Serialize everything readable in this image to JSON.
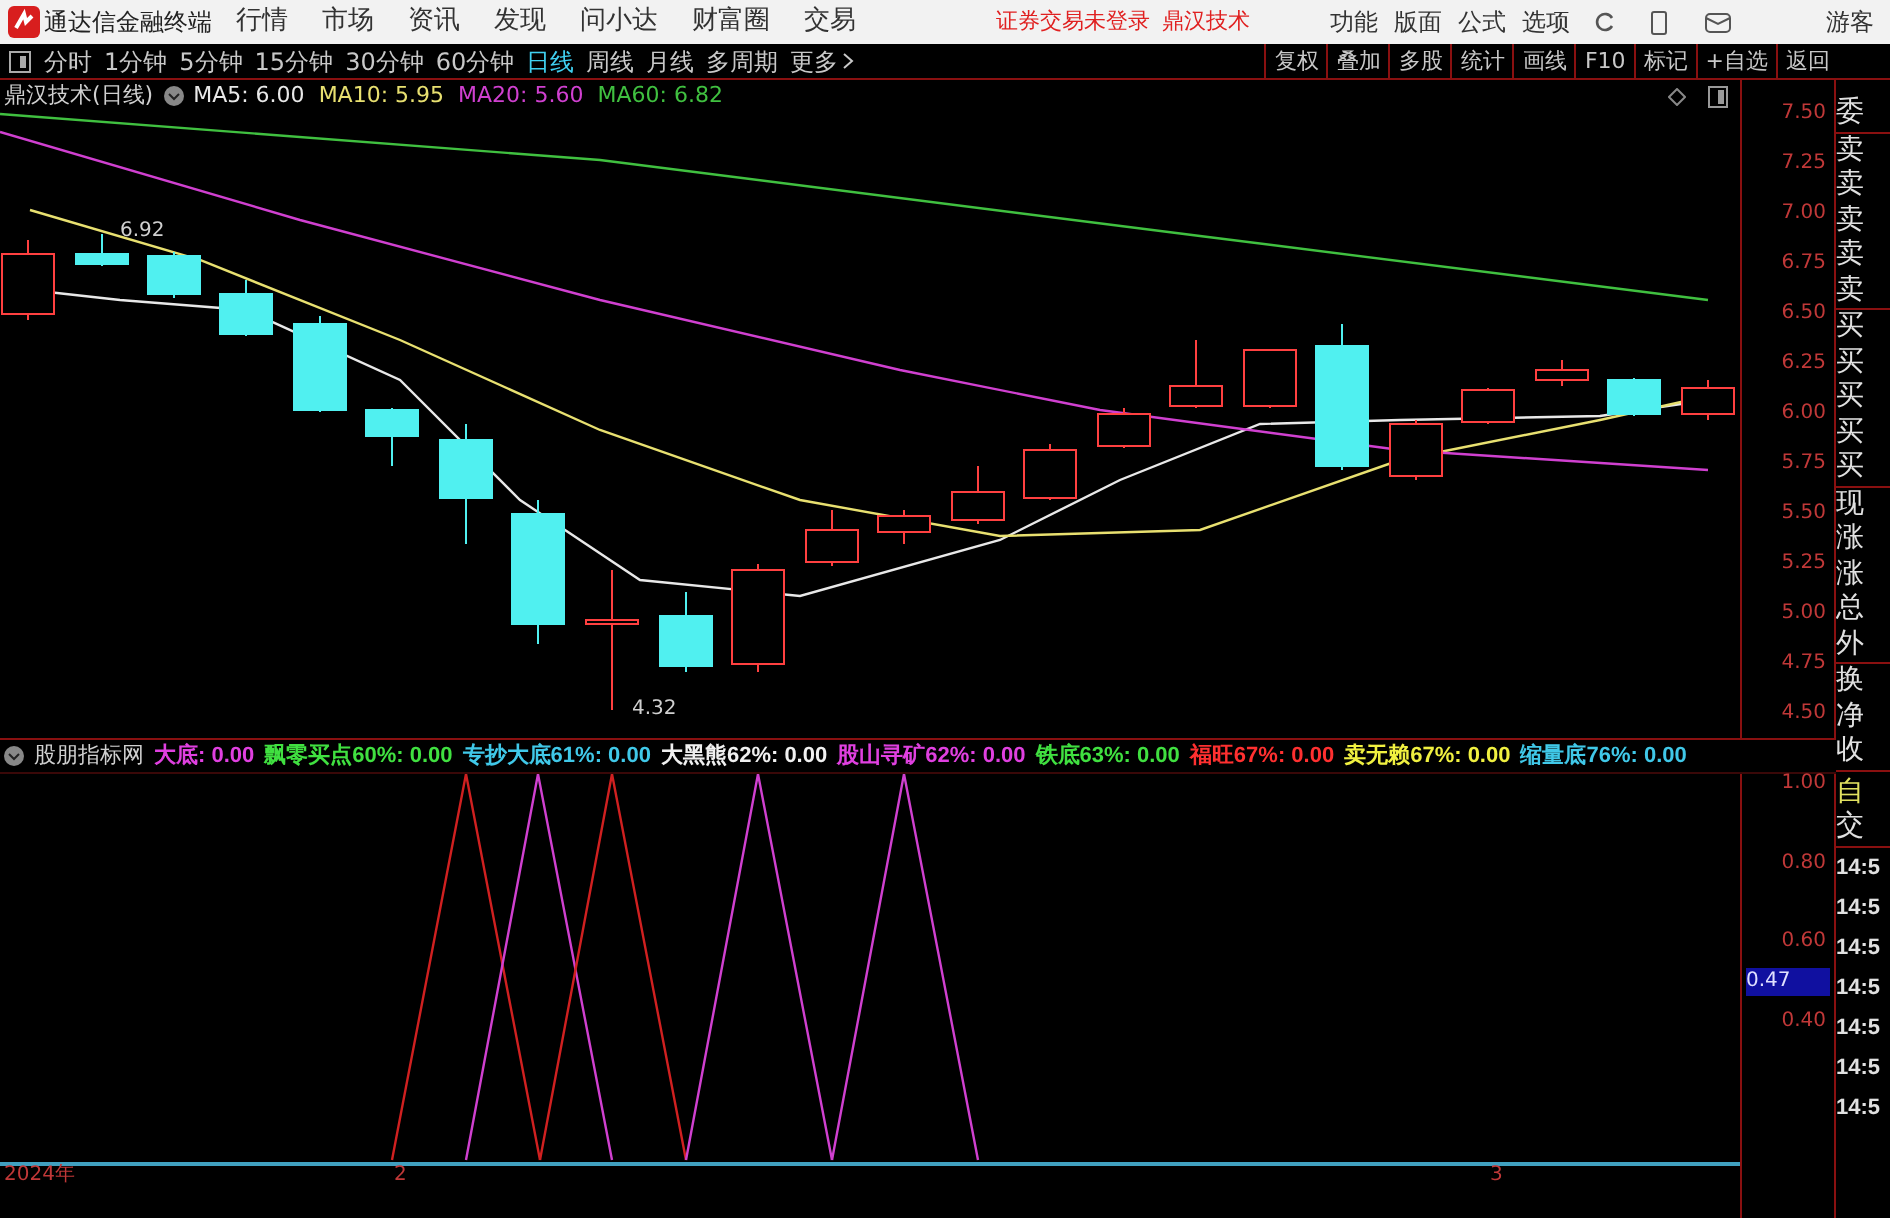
{
  "app_bar": {
    "title": "通达信金融终端",
    "menu": [
      "行情",
      "市场",
      "资讯",
      "发现",
      "问小达",
      "财富圈",
      "交易"
    ],
    "notices": [
      "证券交易未登录",
      "鼎汉技术"
    ],
    "right_menu": [
      "功能",
      "版面",
      "公式",
      "选项"
    ],
    "user": "游客"
  },
  "period_tabs": [
    {
      "label": "分时",
      "selected": false
    },
    {
      "label": "1分钟",
      "selected": false
    },
    {
      "label": "5分钟",
      "selected": false
    },
    {
      "label": "15分钟",
      "selected": false
    },
    {
      "label": "30分钟",
      "selected": false
    },
    {
      "label": "60分钟",
      "selected": false
    },
    {
      "label": "日线",
      "selected": true
    },
    {
      "label": "周线",
      "selected": false
    },
    {
      "label": "月线",
      "selected": false
    },
    {
      "label": "多周期",
      "selected": false
    },
    {
      "label": "更多",
      "selected": false
    }
  ],
  "tool_buttons": [
    "复权",
    "叠加",
    "多股",
    "统计",
    "画线",
    "F10",
    "标记",
    "+自选",
    "返回"
  ],
  "main_chart": {
    "title": "鼎汉技术(日线)",
    "ma": [
      {
        "label": "MA5: 6.00",
        "color": "#e8e8e8"
      },
      {
        "label": "MA10: 5.95",
        "color": "#e8e070"
      },
      {
        "label": "MA20: 5.60",
        "color": "#d040d0"
      },
      {
        "label": "MA60: 6.82",
        "color": "#40c040"
      }
    ],
    "price_ticks": [
      "7.50",
      "7.25",
      "7.00",
      "6.75",
      "6.50",
      "6.25",
      "6.00",
      "5.75",
      "5.50",
      "5.25",
      "5.00",
      "4.75",
      "4.50"
    ],
    "high_label": "6.92",
    "low_label": "4.32"
  },
  "indicator": {
    "title": "股朋指标网",
    "readouts": [
      {
        "label": "大底: 0.00",
        "color": "#e040e0"
      },
      {
        "label": "飘零买点60%: 0.00",
        "color": "#40e040"
      },
      {
        "label": "专抄大底61%: 0.00",
        "color": "#40c8e8"
      },
      {
        "label": "大黑熊62%: 0.00",
        "color": "#f0f0f0"
      },
      {
        "label": "股山寻矿62%: 0.00",
        "color": "#e040e0"
      },
      {
        "label": "铁底63%: 0.00",
        "color": "#40e040"
      },
      {
        "label": "福旺67%: 0.00",
        "color": "#ff3030"
      },
      {
        "label": "卖无赖67%: 0.00",
        "color": "#f0f040"
      },
      {
        "label": "缩量底76%: 0.00",
        "color": "#40c8e8"
      }
    ],
    "ticks": [
      "1.00",
      "0.80",
      "0.60",
      "0.40"
    ],
    "cursor_value": "0.47"
  },
  "time_axis": [
    "2024年",
    "2",
    "3"
  ],
  "quote_panel": {
    "order_book": [
      "委",
      "卖",
      "卖",
      "卖",
      "卖",
      "卖",
      "买",
      "买",
      "买",
      "买",
      "买"
    ],
    "quote": [
      "现",
      "涨",
      "涨",
      "总",
      "外"
    ],
    "extra": [
      "换",
      "净",
      "收"
    ],
    "action": "自",
    "trades_title": "交",
    "trades": [
      "14:5",
      "14:5",
      "14:5",
      "14:5",
      "14:5",
      "14:5",
      "14:5"
    ]
  }
}
